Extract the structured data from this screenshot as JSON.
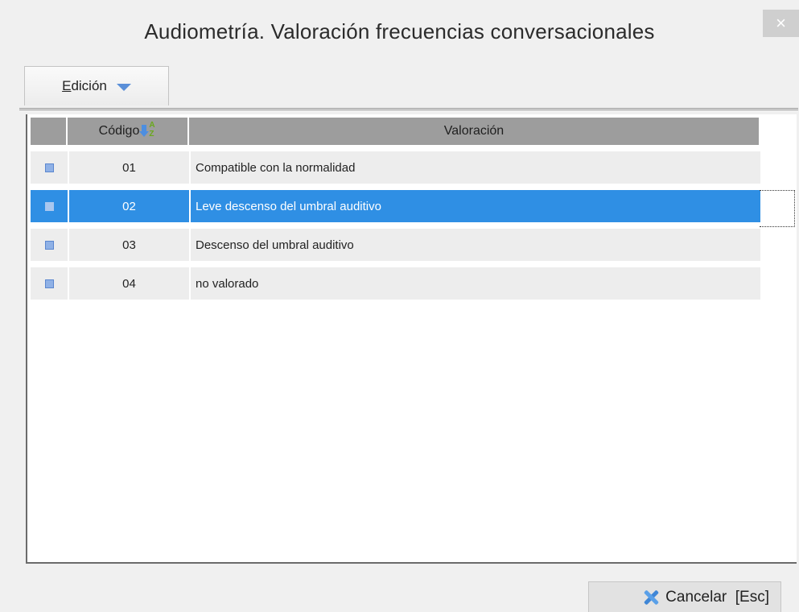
{
  "window": {
    "title": "Audiometría. Valoración frecuencias conversacionales",
    "close_glyph": "×"
  },
  "toolbar": {
    "edit_menu": {
      "first_letter": "E",
      "rest": "dición"
    }
  },
  "table": {
    "columns": [
      "",
      "Código",
      "Valoración"
    ],
    "sort_icon": "sort-az-icon",
    "rows": [
      {
        "code": "01",
        "valoracion": "Compatible con la normalidad",
        "selected": false
      },
      {
        "code": "02",
        "valoracion": "Leve descenso del umbral auditivo",
        "selected": true
      },
      {
        "code": "03",
        "valoracion": "Descenso del umbral auditivo",
        "selected": false
      },
      {
        "code": "04",
        "valoracion": "no valorado",
        "selected": false
      }
    ]
  },
  "footer": {
    "cancel_label": "Cancelar  [Esc]"
  },
  "colors": {
    "selection": "#2f8fe4",
    "header": "#9d9d9d",
    "accent": "#4d8ee0"
  }
}
